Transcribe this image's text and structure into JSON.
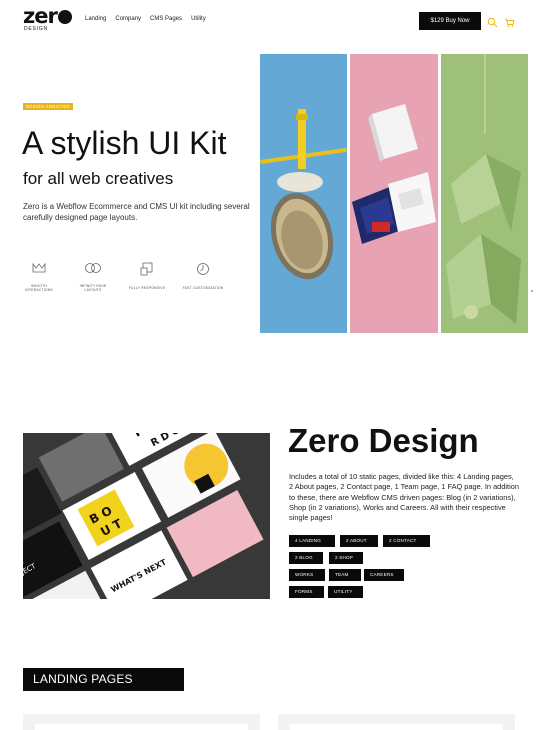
{
  "brand": {
    "logo_word": "zer",
    "logo_sub": "DESIGN"
  },
  "nav": {
    "items": [
      "Landing",
      "Company",
      "CMS Pages",
      "Utility"
    ]
  },
  "header": {
    "buy_label": "$129 Buy Now"
  },
  "hero": {
    "badge": "DESIGN ADDICTED",
    "title": "A stylish UI Kit",
    "subtitle": "for all web creatives",
    "description": "Zero is a Webflow Ecommerce and CMS UI kit including several carefully designed page layouts.",
    "features": [
      {
        "icon": "crown-icon",
        "label": "SMOOTH INTERACTIONS"
      },
      {
        "icon": "infinity-icon",
        "label": "INFINITY PAGE LAYOUTS"
      },
      {
        "icon": "responsive-icon",
        "label": "FULLY RESPONSIVE"
      },
      {
        "icon": "gauge-icon",
        "label": "FAST CUSTOMIZATION"
      }
    ],
    "panel_colors": [
      "#6aaed8",
      "#e8a4b4",
      "#9dbf76"
    ]
  },
  "zero_design": {
    "title": "Zero Design",
    "description": "Includes a total of 10 static pages, divided like this: 4 Landing pages, 2 About pages, 2 Contact page, 1 Team page, 1 FAQ page. In addition to these, there are Webflow CMS driven pages: Blog (in 2 variations), Shop (in 2 variations), Works and Careers. All with their respective single pages!",
    "tags": [
      "4 LANDING",
      "2 ABOUT",
      "2 CONTACT",
      "2 BLOG",
      "2 SHOP",
      "WORKS",
      "TEAM",
      "CAREERS",
      "FORMS",
      "UTILITY"
    ]
  },
  "landing": {
    "section_label": "LANDING PAGES"
  },
  "colors": {
    "accent": "#e9b417",
    "dark": "#0a0a0a"
  }
}
